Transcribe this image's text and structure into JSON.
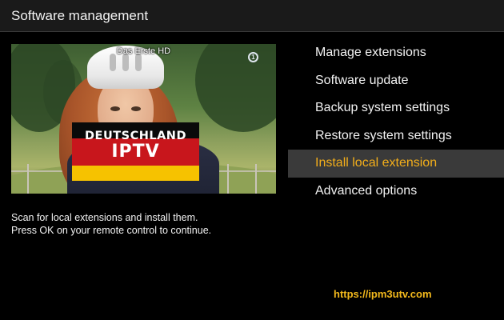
{
  "window": {
    "title": "Software management"
  },
  "preview": {
    "channel_name": "Das Erste HD",
    "channel_logo": "1",
    "overlay_line1": "DEUTSCHLAND",
    "overlay_line2": "IPTV"
  },
  "menu": {
    "items": [
      {
        "label": "Manage extensions",
        "selected": false
      },
      {
        "label": "Software update",
        "selected": false
      },
      {
        "label": "Backup system settings",
        "selected": false
      },
      {
        "label": "Restore system settings",
        "selected": false
      },
      {
        "label": "Install local extension",
        "selected": true
      },
      {
        "label": "Advanced options",
        "selected": false
      }
    ]
  },
  "description": {
    "line1": "Scan for local extensions and install them.",
    "line2": "Press OK on your remote control to continue."
  },
  "watermark": {
    "url": "https://ipm3utv.com"
  },
  "colors": {
    "background": "#000000",
    "header": "#1a1a1a",
    "selected_bg": "#3a3a3a",
    "accent": "#f3ae1a"
  }
}
